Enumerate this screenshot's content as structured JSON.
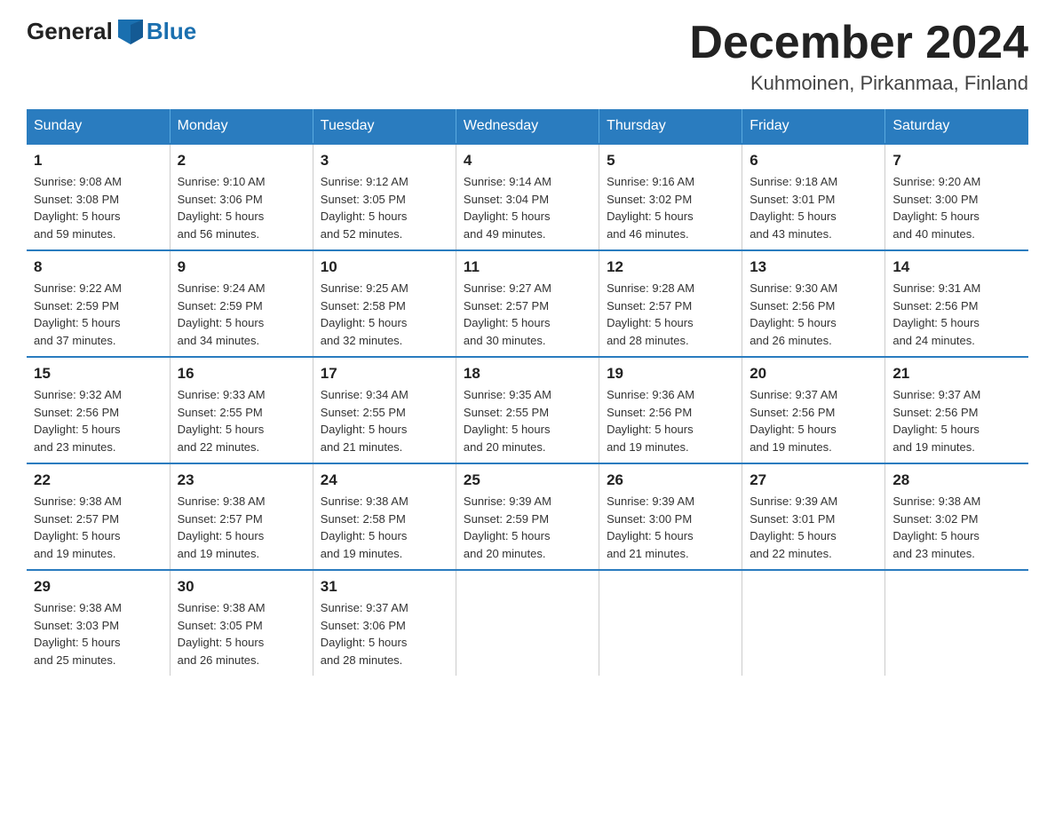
{
  "logo": {
    "text_general": "General",
    "text_blue": "Blue"
  },
  "header": {
    "month_title": "December 2024",
    "location": "Kuhmoinen, Pirkanmaa, Finland"
  },
  "weekdays": [
    "Sunday",
    "Monday",
    "Tuesday",
    "Wednesday",
    "Thursday",
    "Friday",
    "Saturday"
  ],
  "weeks": [
    [
      {
        "day": "1",
        "sunrise": "9:08 AM",
        "sunset": "3:08 PM",
        "daylight": "5 hours and 59 minutes."
      },
      {
        "day": "2",
        "sunrise": "9:10 AM",
        "sunset": "3:06 PM",
        "daylight": "5 hours and 56 minutes."
      },
      {
        "day": "3",
        "sunrise": "9:12 AM",
        "sunset": "3:05 PM",
        "daylight": "5 hours and 52 minutes."
      },
      {
        "day": "4",
        "sunrise": "9:14 AM",
        "sunset": "3:04 PM",
        "daylight": "5 hours and 49 minutes."
      },
      {
        "day": "5",
        "sunrise": "9:16 AM",
        "sunset": "3:02 PM",
        "daylight": "5 hours and 46 minutes."
      },
      {
        "day": "6",
        "sunrise": "9:18 AM",
        "sunset": "3:01 PM",
        "daylight": "5 hours and 43 minutes."
      },
      {
        "day": "7",
        "sunrise": "9:20 AM",
        "sunset": "3:00 PM",
        "daylight": "5 hours and 40 minutes."
      }
    ],
    [
      {
        "day": "8",
        "sunrise": "9:22 AM",
        "sunset": "2:59 PM",
        "daylight": "5 hours and 37 minutes."
      },
      {
        "day": "9",
        "sunrise": "9:24 AM",
        "sunset": "2:59 PM",
        "daylight": "5 hours and 34 minutes."
      },
      {
        "day": "10",
        "sunrise": "9:25 AM",
        "sunset": "2:58 PM",
        "daylight": "5 hours and 32 minutes."
      },
      {
        "day": "11",
        "sunrise": "9:27 AM",
        "sunset": "2:57 PM",
        "daylight": "5 hours and 30 minutes."
      },
      {
        "day": "12",
        "sunrise": "9:28 AM",
        "sunset": "2:57 PM",
        "daylight": "5 hours and 28 minutes."
      },
      {
        "day": "13",
        "sunrise": "9:30 AM",
        "sunset": "2:56 PM",
        "daylight": "5 hours and 26 minutes."
      },
      {
        "day": "14",
        "sunrise": "9:31 AM",
        "sunset": "2:56 PM",
        "daylight": "5 hours and 24 minutes."
      }
    ],
    [
      {
        "day": "15",
        "sunrise": "9:32 AM",
        "sunset": "2:56 PM",
        "daylight": "5 hours and 23 minutes."
      },
      {
        "day": "16",
        "sunrise": "9:33 AM",
        "sunset": "2:55 PM",
        "daylight": "5 hours and 22 minutes."
      },
      {
        "day": "17",
        "sunrise": "9:34 AM",
        "sunset": "2:55 PM",
        "daylight": "5 hours and 21 minutes."
      },
      {
        "day": "18",
        "sunrise": "9:35 AM",
        "sunset": "2:55 PM",
        "daylight": "5 hours and 20 minutes."
      },
      {
        "day": "19",
        "sunrise": "9:36 AM",
        "sunset": "2:56 PM",
        "daylight": "5 hours and 19 minutes."
      },
      {
        "day": "20",
        "sunrise": "9:37 AM",
        "sunset": "2:56 PM",
        "daylight": "5 hours and 19 minutes."
      },
      {
        "day": "21",
        "sunrise": "9:37 AM",
        "sunset": "2:56 PM",
        "daylight": "5 hours and 19 minutes."
      }
    ],
    [
      {
        "day": "22",
        "sunrise": "9:38 AM",
        "sunset": "2:57 PM",
        "daylight": "5 hours and 19 minutes."
      },
      {
        "day": "23",
        "sunrise": "9:38 AM",
        "sunset": "2:57 PM",
        "daylight": "5 hours and 19 minutes."
      },
      {
        "day": "24",
        "sunrise": "9:38 AM",
        "sunset": "2:58 PM",
        "daylight": "5 hours and 19 minutes."
      },
      {
        "day": "25",
        "sunrise": "9:39 AM",
        "sunset": "2:59 PM",
        "daylight": "5 hours and 20 minutes."
      },
      {
        "day": "26",
        "sunrise": "9:39 AM",
        "sunset": "3:00 PM",
        "daylight": "5 hours and 21 minutes."
      },
      {
        "day": "27",
        "sunrise": "9:39 AM",
        "sunset": "3:01 PM",
        "daylight": "5 hours and 22 minutes."
      },
      {
        "day": "28",
        "sunrise": "9:38 AM",
        "sunset": "3:02 PM",
        "daylight": "5 hours and 23 minutes."
      }
    ],
    [
      {
        "day": "29",
        "sunrise": "9:38 AM",
        "sunset": "3:03 PM",
        "daylight": "5 hours and 25 minutes."
      },
      {
        "day": "30",
        "sunrise": "9:38 AM",
        "sunset": "3:05 PM",
        "daylight": "5 hours and 26 minutes."
      },
      {
        "day": "31",
        "sunrise": "9:37 AM",
        "sunset": "3:06 PM",
        "daylight": "5 hours and 28 minutes."
      },
      null,
      null,
      null,
      null
    ]
  ],
  "labels": {
    "sunrise": "Sunrise:",
    "sunset": "Sunset:",
    "daylight": "Daylight:"
  }
}
